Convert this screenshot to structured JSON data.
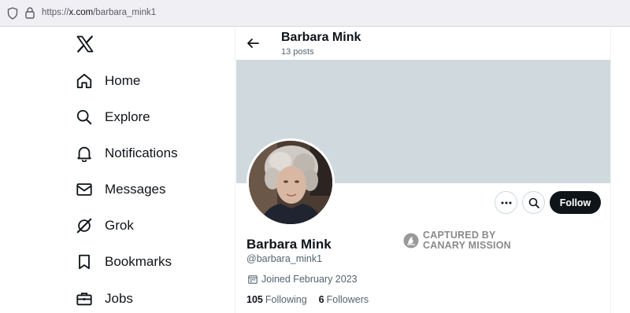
{
  "browser": {
    "url_scheme": "https://",
    "url_host": "x.com",
    "url_path": "/barbara_mink1"
  },
  "nav": {
    "logo": "x-logo-icon",
    "items": [
      {
        "label": "Home",
        "icon": "home-icon"
      },
      {
        "label": "Explore",
        "icon": "search-icon"
      },
      {
        "label": "Notifications",
        "icon": "bell-icon"
      },
      {
        "label": "Messages",
        "icon": "envelope-icon"
      },
      {
        "label": "Grok",
        "icon": "grok-icon"
      },
      {
        "label": "Bookmarks",
        "icon": "bookmark-icon"
      },
      {
        "label": "Jobs",
        "icon": "briefcase-icon"
      }
    ]
  },
  "header": {
    "name": "Barbara Mink",
    "post_count": "13 posts"
  },
  "profile": {
    "name": "Barbara Mink",
    "handle": "@barbara_mink1",
    "joined": "Joined February 2023",
    "following_count": "105",
    "following_label": "Following",
    "followers_count": "6",
    "followers_label": "Followers",
    "follow_label": "Follow"
  },
  "watermark": {
    "line1": "CAPTURED BY",
    "line2": "CANARY MISSION"
  },
  "colors": {
    "banner": "#cfd9de",
    "follow_button": "#0f1419",
    "secondary_text": "#536471"
  }
}
